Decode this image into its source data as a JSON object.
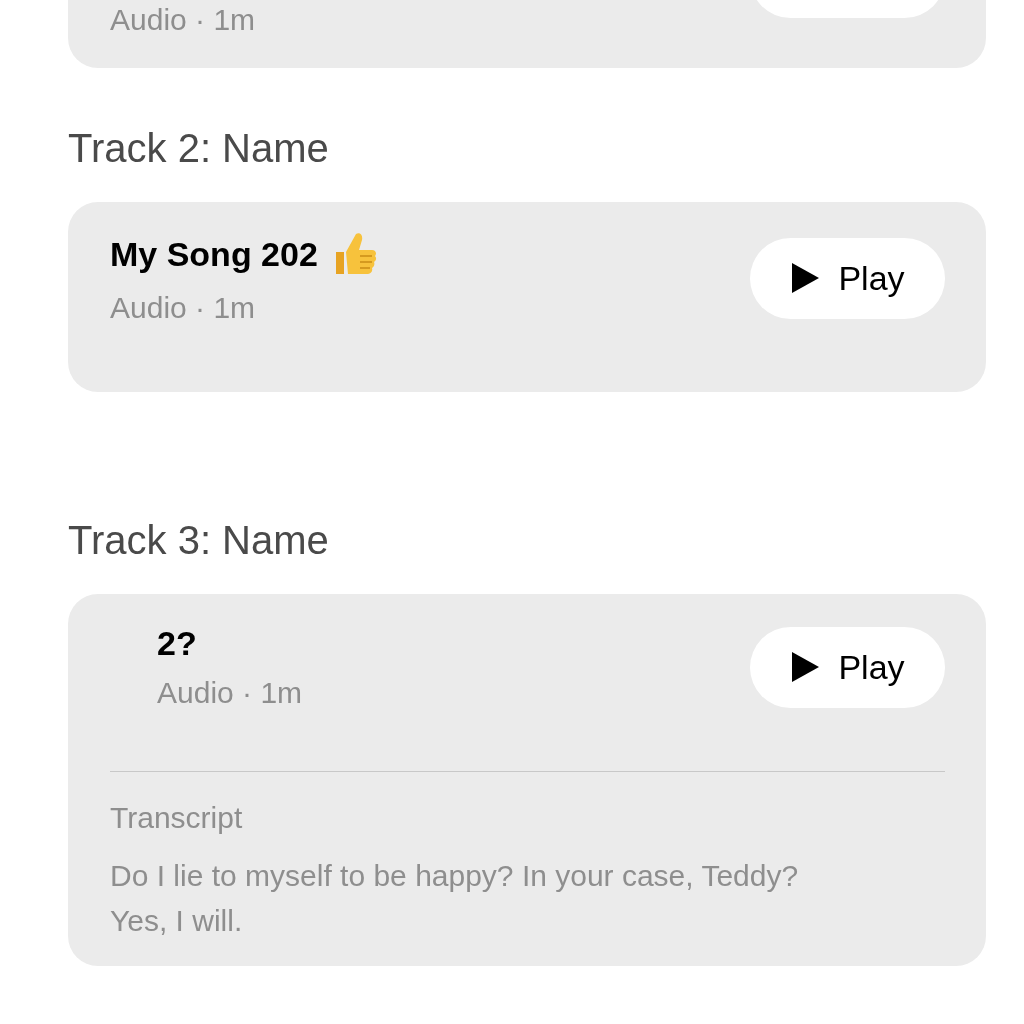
{
  "tracks": [
    {
      "subtitle": "Audio · 1m"
    },
    {
      "heading": "Track 2: Name",
      "title": "My Song 202",
      "thumbs_up": true,
      "subtitle": "Audio · 1m",
      "play_label": "Play",
      "indented": false
    },
    {
      "heading": "Track 3: Name",
      "title": "2?",
      "thumbs_up": false,
      "subtitle": "Audio · 1m",
      "play_label": "Play",
      "indented": true,
      "transcript": {
        "label": "Transcript",
        "text": "Do I lie to myself to be happy? In your case, Teddy? Yes, I will."
      }
    }
  ]
}
